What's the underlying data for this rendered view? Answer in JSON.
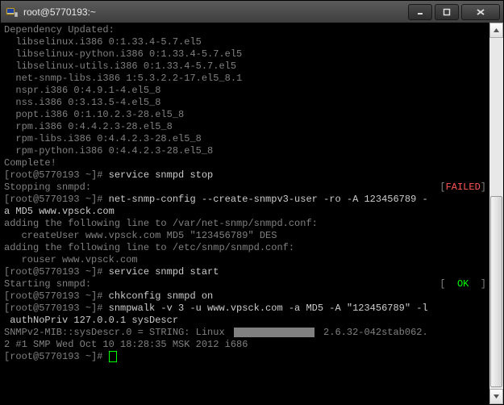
{
  "window": {
    "title": "root@5770193:~",
    "icon": "putty-icon"
  },
  "controls": {
    "minimize": "minimize-icon",
    "maximize": "maximize-icon",
    "close": "close-icon"
  },
  "scrollbar": {
    "up": "up-arrow",
    "down": "down-arrow",
    "thumb_top_pct": 45,
    "thumb_height_pct": 54
  },
  "lines": [
    {
      "t": "",
      "c": ""
    },
    {
      "t": "Dependency Updated:",
      "c": ""
    },
    {
      "t": "  libselinux.i386 0:1.33.4-5.7.el5",
      "c": ""
    },
    {
      "t": "  libselinux-python.i386 0:1.33.4-5.7.el5",
      "c": ""
    },
    {
      "t": "  libselinux-utils.i386 0:1.33.4-5.7.el5",
      "c": ""
    },
    {
      "t": "  net-snmp-libs.i386 1:5.3.2.2-17.el5_8.1",
      "c": ""
    },
    {
      "t": "  nspr.i386 0:4.9.1-4.el5_8",
      "c": ""
    },
    {
      "t": "  nss.i386 0:3.13.5-4.el5_8",
      "c": ""
    },
    {
      "t": "  popt.i386 0:1.10.2.3-28.el5_8",
      "c": ""
    },
    {
      "t": "  rpm.i386 0:4.4.2.3-28.el5_8",
      "c": ""
    },
    {
      "t": "  rpm-libs.i386 0:4.4.2.3-28.el5_8",
      "c": ""
    },
    {
      "t": "  rpm-python.i386 0:4.4.2.3-28.el5_8",
      "c": ""
    },
    {
      "t": "",
      "c": ""
    },
    {
      "t": "Complete!",
      "c": ""
    }
  ],
  "prompt1": {
    "host": "[root@5770193 ~]#",
    "cmd": " service snmpd stop"
  },
  "stopping": {
    "label": "Stopping snmpd:",
    "status_open": "[",
    "status_text": "FAILED",
    "status_close": "]"
  },
  "prompt2": {
    "host": "[root@5770193 ~]#",
    "cmd": " net-snmp-config --create-snmpv3-user -ro -A 123456789 -"
  },
  "prompt2b": "a MD5 www.vpsck.com",
  "add1": "adding the following line to /var/net-snmp/snmpd.conf:",
  "add1b": "   createUser www.vpsck.com MD5 \"123456789\" DES",
  "add2": "adding the following line to /etc/snmp/snmpd.conf:",
  "add2b": "   rouser www.vpsck.com",
  "prompt3": {
    "host": "[root@5770193 ~]#",
    "cmd": " service snmpd start"
  },
  "starting": {
    "label": "Starting snmpd:",
    "status_open": "[",
    "status_text": "  OK  ",
    "status_close": "]"
  },
  "prompt4": {
    "host": "[root@5770193 ~]#",
    "cmd": " chkconfig snmpd on"
  },
  "prompt5": {
    "host": "[root@5770193 ~]#",
    "cmd": " snmpwalk -v 3 -u www.vpsck.com -a MD5 -A \"123456789\" -l"
  },
  "prompt5b": " authNoPriv 127.0.0.1 sysDescr",
  "snmpout1a": "SNMPv2-MIB::sysDescr.0 = STRING: Linux ",
  "snmpout1b": " 2.6.32-042stab062.",
  "snmpout2": "2 #1 SMP Wed Oct 10 18:28:35 MSK 2012 i686",
  "prompt6": {
    "host": "[root@5770193 ~]#",
    "cmd": " "
  }
}
